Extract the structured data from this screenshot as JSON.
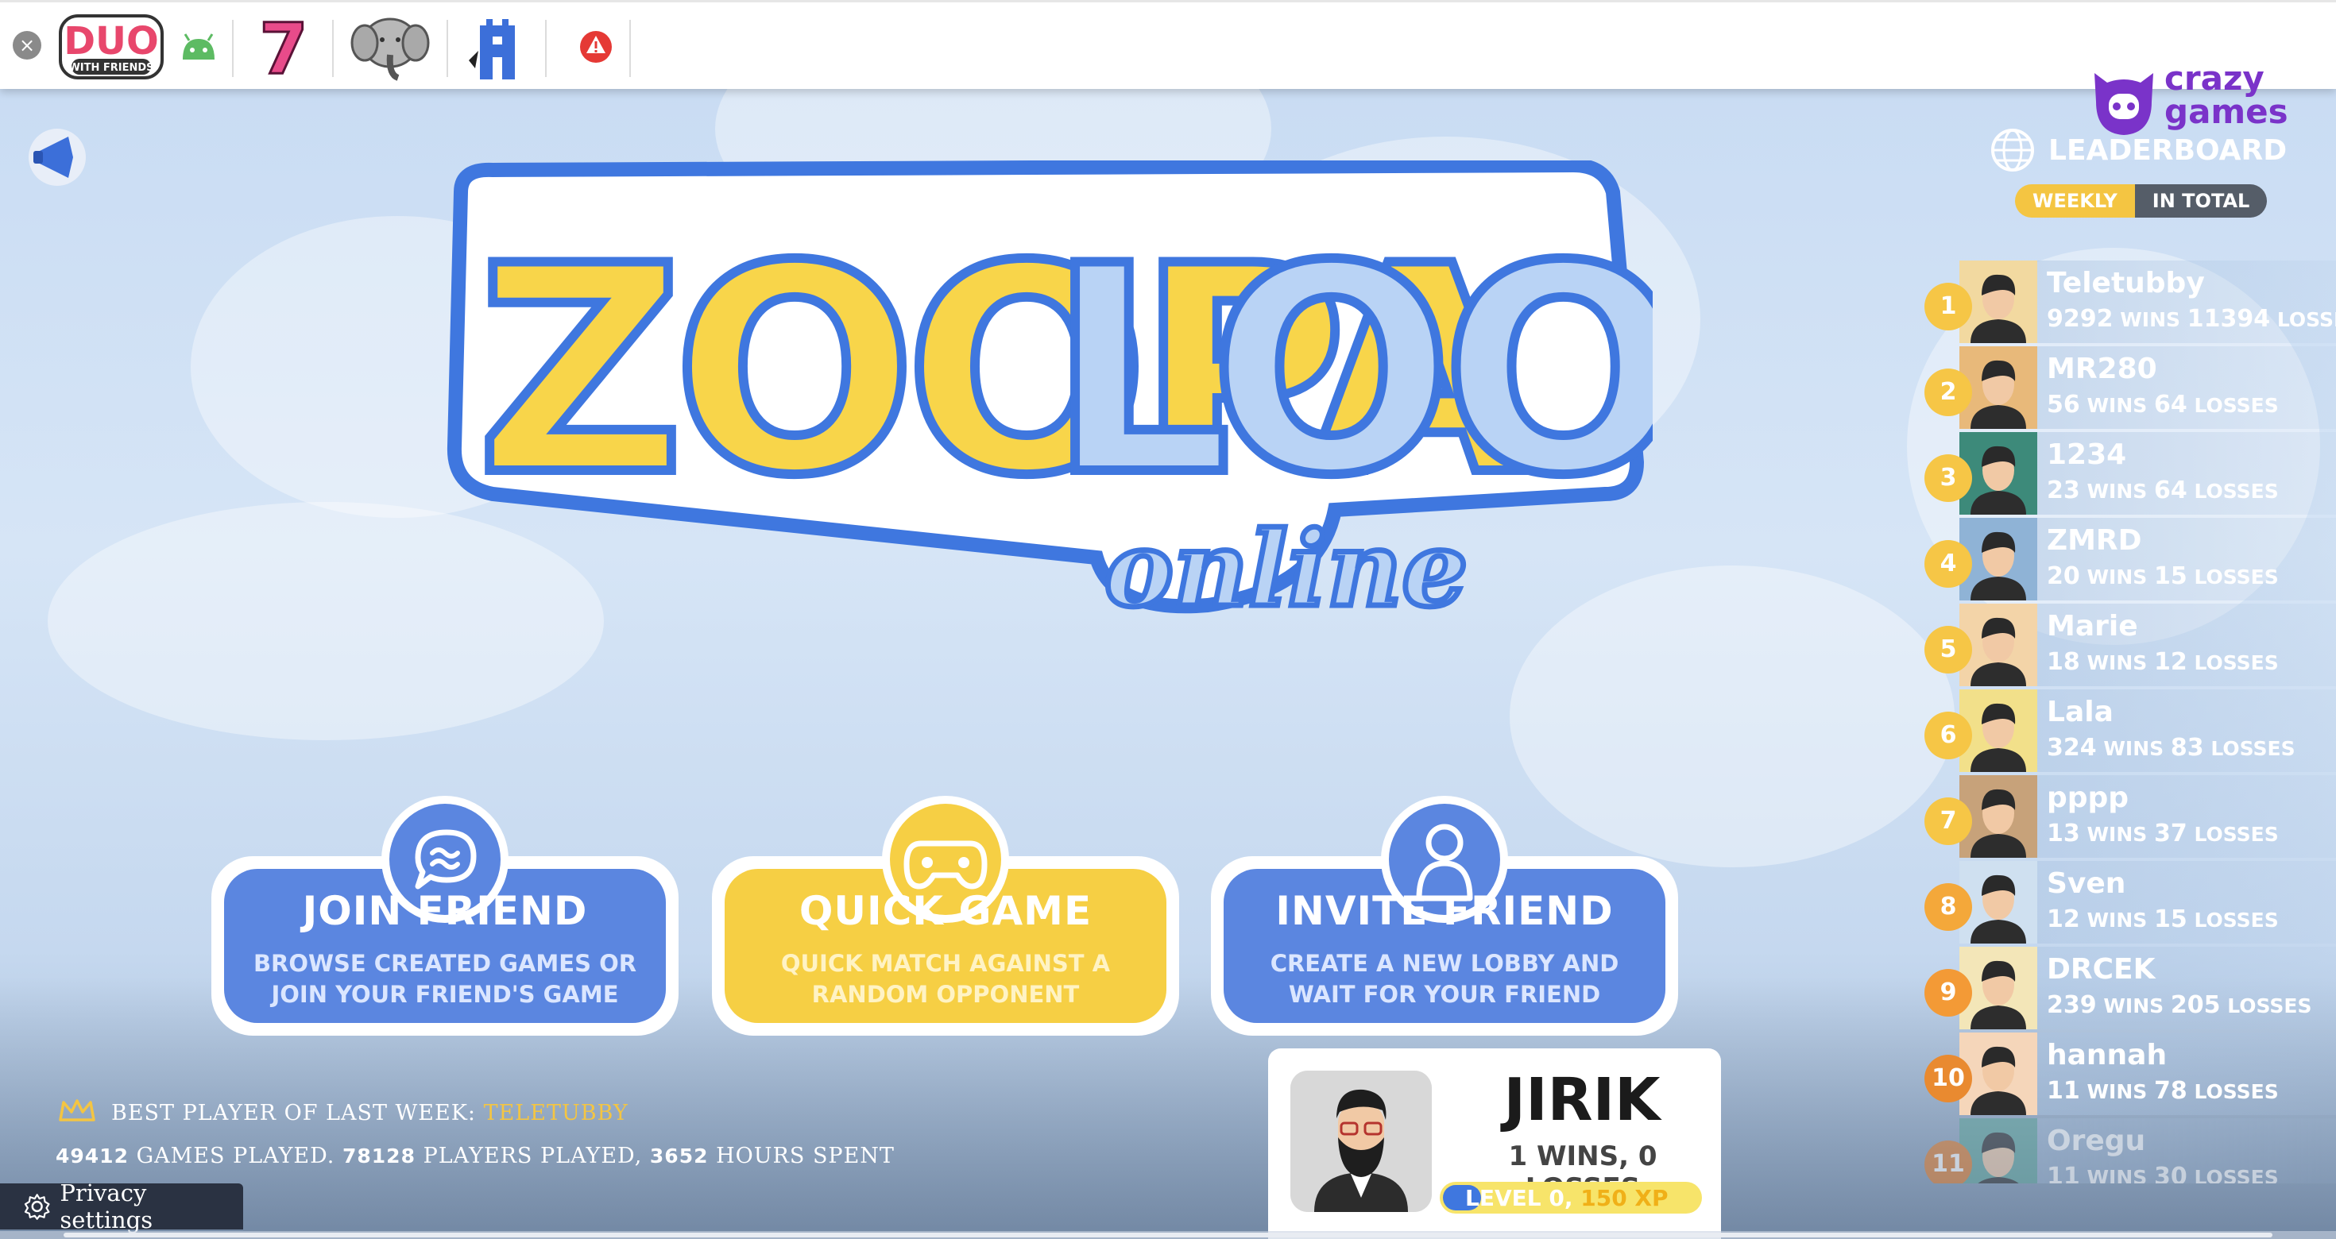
{
  "topbar": {
    "items": [
      {
        "name": "duo-with-friends-icon",
        "label": "DUO",
        "sublabel": "WITH FRIENDS"
      },
      {
        "name": "android-icon"
      },
      {
        "name": "slot-seven-icon",
        "label": "7"
      },
      {
        "name": "elephant-icon"
      },
      {
        "name": "castle-icon"
      },
      {
        "name": "alert-icon"
      }
    ]
  },
  "logo": {
    "line1_a": "ZOOPA",
    "line1_b": "LOOLA",
    "line2": "online"
  },
  "buttons": [
    {
      "title": "JOIN FRIEND",
      "desc": "BROWSE CREATED GAMES OR JOIN YOUR FRIEND'S GAME",
      "icon": "chat-bubble-icon",
      "color": "#5b86e0"
    },
    {
      "title": "QUICK GAME",
      "desc": "QUICK MATCH AGAINST A RANDOM OPPONENT",
      "icon": "gamepad-icon",
      "color": "#f6cf44"
    },
    {
      "title": "INVITE FRIEND",
      "desc": "CREATE A NEW LOBBY AND WAIT FOR YOUR FRIEND",
      "icon": "person-icon",
      "color": "#5b86e0"
    }
  ],
  "stats": {
    "best_label": "BEST PLAYER OF LAST WEEK:",
    "best_name": "TELETUBBY",
    "games_played": "49412",
    "games_label": "GAMES PLAYED.",
    "players_played": "78128",
    "players_label": "PLAYERS PLAYED,",
    "hours_spent": "3652",
    "hours_label": "HOURS SPENT"
  },
  "privacy": {
    "label": "Privacy settings"
  },
  "player": {
    "name": "JIRIK",
    "record": "1 WINS, 0 LOSSES",
    "level": "LEVEL 0,",
    "xp": "150 XP"
  },
  "brand": {
    "line1": "crazy",
    "line2": "games",
    "color": "#7a33c9"
  },
  "leaderboard": {
    "title": "LEADERBOARD",
    "tabs": [
      {
        "label": "WEEKLY",
        "active": true
      },
      {
        "label": "IN TOTAL",
        "active": false
      }
    ],
    "wins_word": "WINS",
    "losses_word": "LOSSES",
    "rows": [
      {
        "rank": "1",
        "name": "Teletubby",
        "wins": "9292",
        "losses": "11394",
        "avatar_bg": "#f2d9a0"
      },
      {
        "rank": "2",
        "name": "MR280",
        "wins": "56",
        "losses": "64",
        "avatar_bg": "#e8b97a"
      },
      {
        "rank": "3",
        "name": "1234",
        "wins": "23",
        "losses": "64",
        "avatar_bg": "#3d8a7a"
      },
      {
        "rank": "4",
        "name": "ZMRD",
        "wins": "20",
        "losses": "15",
        "avatar_bg": "#8fb3d6"
      },
      {
        "rank": "5",
        "name": "Marie",
        "wins": "18",
        "losses": "12",
        "avatar_bg": "#f3d4a8"
      },
      {
        "rank": "6",
        "name": "Lala",
        "wins": "324",
        "losses": "83",
        "avatar_bg": "#f2e08a"
      },
      {
        "rank": "7",
        "name": "pppp",
        "wins": "13",
        "losses": "37",
        "avatar_bg": "#c7a27a"
      },
      {
        "rank": "8",
        "name": "Sven",
        "wins": "12",
        "losses": "15",
        "avatar_bg": "#cfe0f0"
      },
      {
        "rank": "9",
        "name": "DRCEK",
        "wins": "239",
        "losses": "205",
        "avatar_bg": "#f3e6b8"
      },
      {
        "rank": "10",
        "name": "hannah",
        "wins": "11",
        "losses": "78",
        "avatar_bg": "#f5d6ba"
      },
      {
        "rank": "11",
        "name": "Oregu",
        "wins": "11",
        "losses": "30",
        "avatar_bg": "#5fa39a"
      }
    ]
  }
}
